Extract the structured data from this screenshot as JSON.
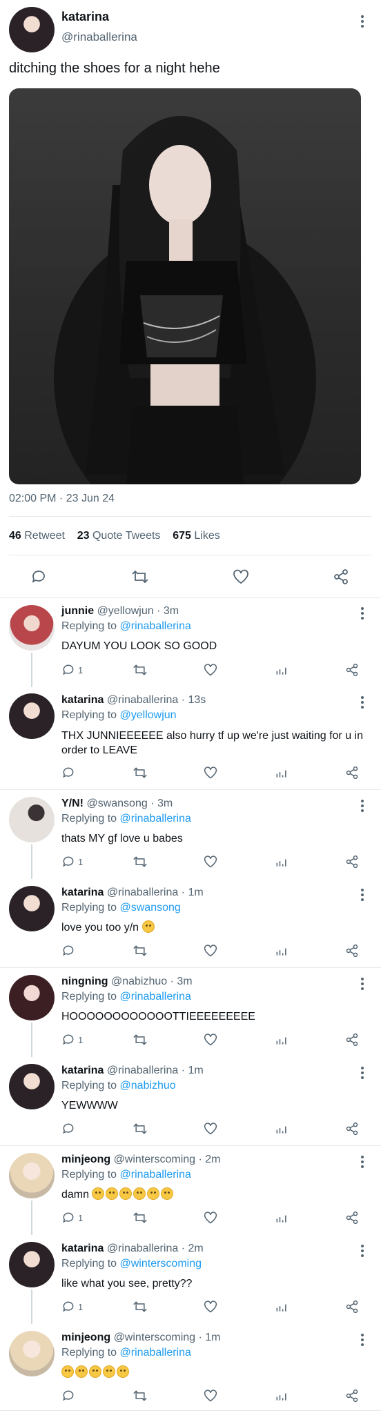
{
  "tweet": {
    "author_name": "katarina",
    "author_handle": "@rinaballerina",
    "text": "ditching the shoes for a night hehe",
    "timestamp": "02:00 PM · 23 Jun 24",
    "retweets": "46",
    "retweets_label": "Retweet",
    "quotes": "23",
    "quotes_label": "Quote Tweets",
    "likes": "675",
    "likes_label": "Likes"
  },
  "replies": [
    {
      "name": "junnie",
      "handle": "@yellowjun · 3m",
      "replying_label": "Replying to",
      "replying_to": "@rinaballerina",
      "text": "DAYUM YOU LOOK SO GOOD",
      "reply_count": "1"
    },
    {
      "name": "katarina",
      "handle": "@rinaballerina · 13s",
      "replying_label": "Replying to",
      "replying_to": "@yellowjun",
      "text": "THX JUNNIEEEEEE also hurry tf up we're just waiting for u in order to LEAVE",
      "reply_count": ""
    },
    {
      "name": "Y/N!",
      "handle": "@swansong · 3m",
      "replying_label": "Replying to",
      "replying_to": "@rinaballerina",
      "text": "thats MY gf love u babes",
      "reply_count": "1"
    },
    {
      "name": "katarina",
      "handle": "@rinaballerina · 1m",
      "replying_label": "Replying to",
      "replying_to": "@swansong",
      "text": "love you too y/n",
      "reply_count": ""
    },
    {
      "name": "ningning",
      "handle": "@nabizhuo · 3m",
      "replying_label": "Replying to",
      "replying_to": "@rinaballerina",
      "text": "HOOOOOOOOOOOOTTIEEEEEEEEE",
      "reply_count": "1"
    },
    {
      "name": "katarina",
      "handle": "@rinaballerina · 1m",
      "replying_label": "Replying to",
      "replying_to": "@nabizhuo",
      "text": "YEWWWW",
      "reply_count": ""
    },
    {
      "name": "minjeong",
      "handle": "@winterscoming · 2m",
      "replying_label": "Replying to",
      "replying_to": "@rinaballerina",
      "text": "damn",
      "reply_count": "1"
    },
    {
      "name": "katarina",
      "handle": "@rinaballerina · 2m",
      "replying_label": "Replying to",
      "replying_to": "@winterscoming",
      "text": "like what you see, pretty??",
      "reply_count": "1"
    },
    {
      "name": "minjeong",
      "handle": "@winterscoming · 1m",
      "replying_label": "Replying to",
      "replying_to": "@rinaballerina",
      "text": "",
      "reply_count": ""
    }
  ],
  "icons": [
    "more-icon",
    "reply-icon",
    "retweet-icon",
    "like-icon",
    "views-icon",
    "share-icon"
  ]
}
